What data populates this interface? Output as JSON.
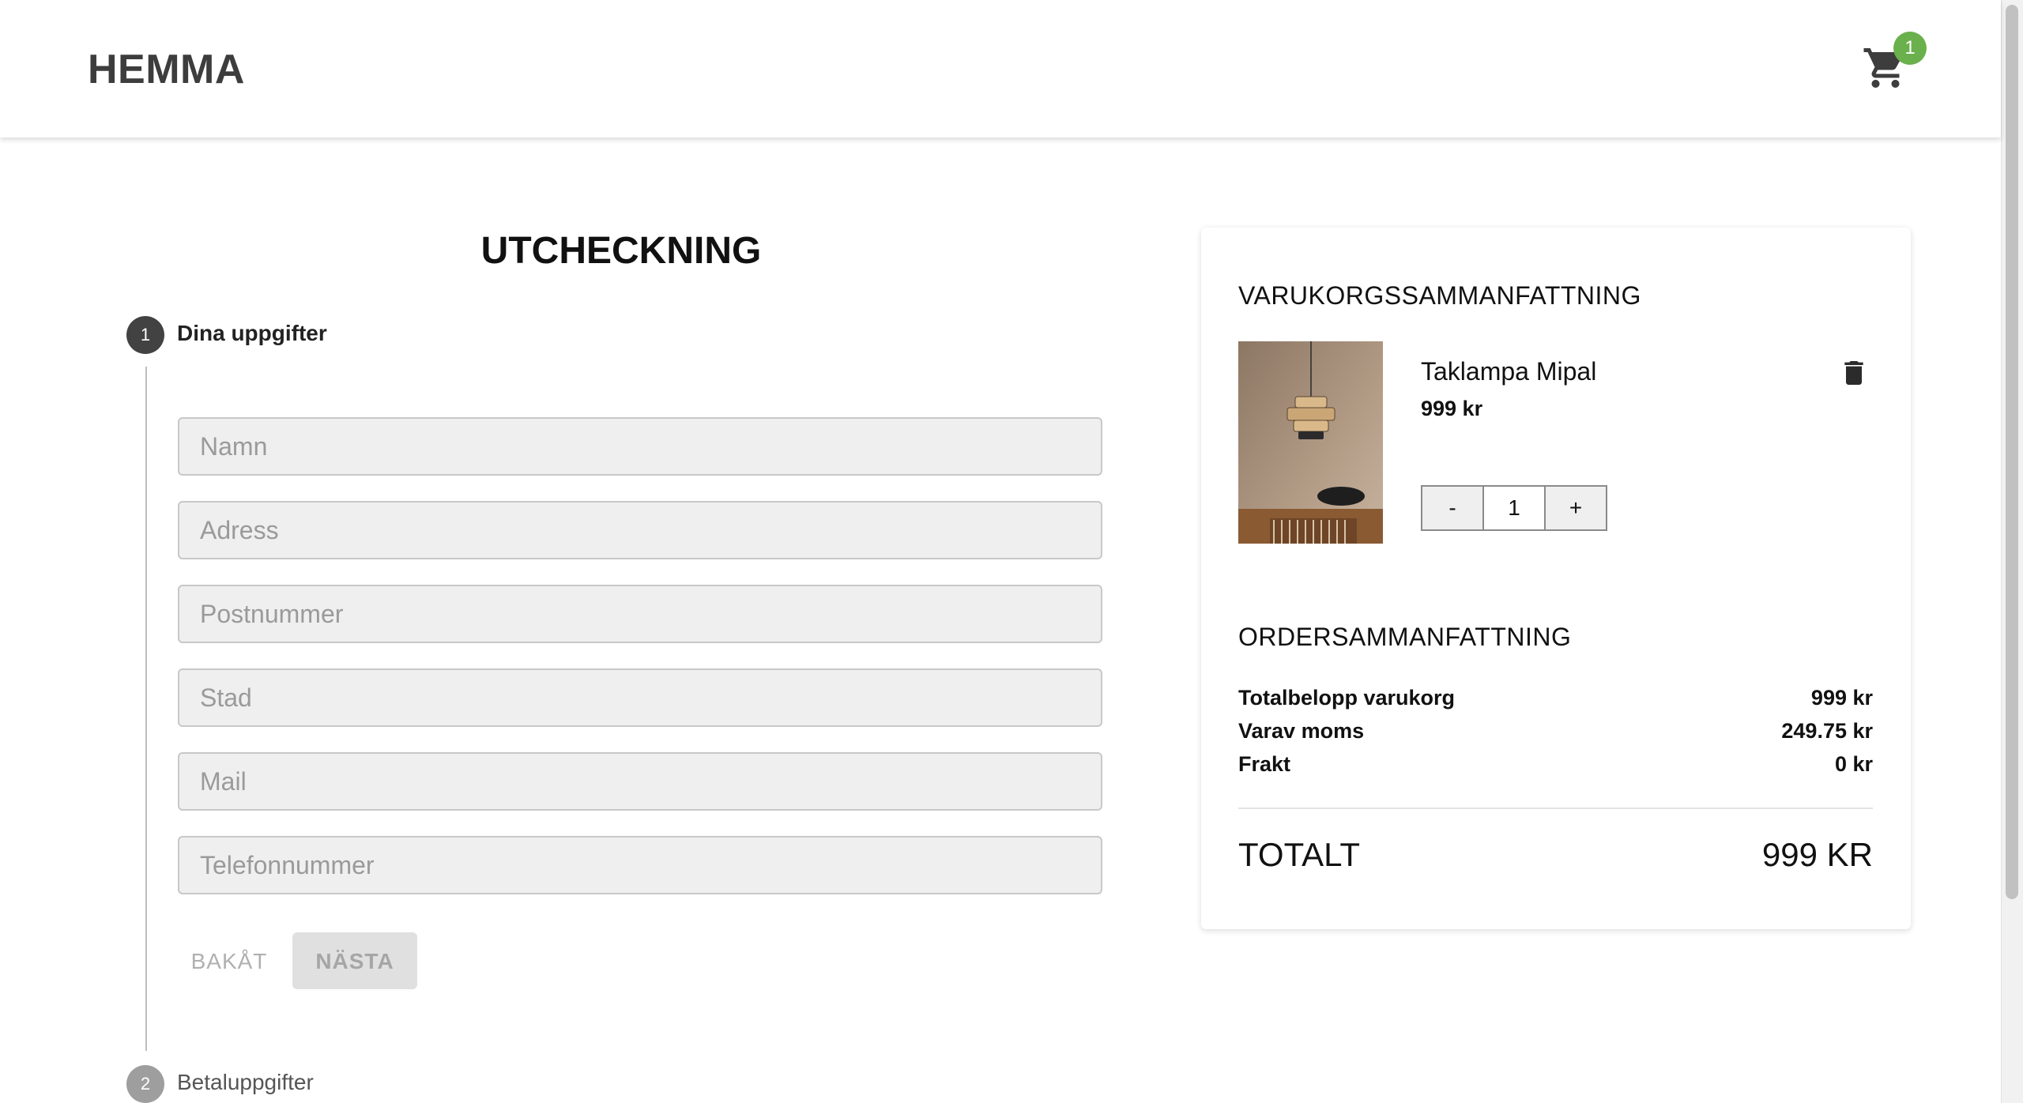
{
  "header": {
    "logo": "HEMMA",
    "cart_count": "1"
  },
  "checkout": {
    "title": "UTCHECKNING",
    "steps": [
      {
        "number": "1",
        "label": "Dina uppgifter",
        "state": "active"
      },
      {
        "number": "2",
        "label": "Betaluppgifter",
        "state": "inactive"
      }
    ],
    "fields": [
      {
        "placeholder": "Namn",
        "value": ""
      },
      {
        "placeholder": "Adress",
        "value": ""
      },
      {
        "placeholder": "Postnummer",
        "value": ""
      },
      {
        "placeholder": "Stad",
        "value": ""
      },
      {
        "placeholder": "Mail",
        "value": ""
      },
      {
        "placeholder": "Telefonnummer",
        "value": ""
      }
    ],
    "back_label": "BAKÅT",
    "next_label": "NÄSTA"
  },
  "summary": {
    "cart_title": "VARUKORGSSAMMANFATTNING",
    "item": {
      "name": "Taklampa Mipal",
      "price": "999 kr",
      "quantity": "1",
      "minus_label": "-",
      "plus_label": "+"
    },
    "order_title": "ORDERSAMMANFATTNING",
    "rows": [
      {
        "label": "Totalbelopp varukorg",
        "value": "999 kr"
      },
      {
        "label": "Varav moms",
        "value": "249.75 kr"
      },
      {
        "label": "Frakt",
        "value": "0 kr"
      }
    ],
    "total_label": "TOTALT",
    "total_value": "999 KR"
  },
  "colors": {
    "badge": "#6ab04c",
    "step_active": "#424242",
    "step_inactive": "#9e9e9e",
    "field_bg": "#efefef"
  },
  "icons": {
    "cart": "shopping-cart-icon",
    "delete": "trash-icon"
  }
}
